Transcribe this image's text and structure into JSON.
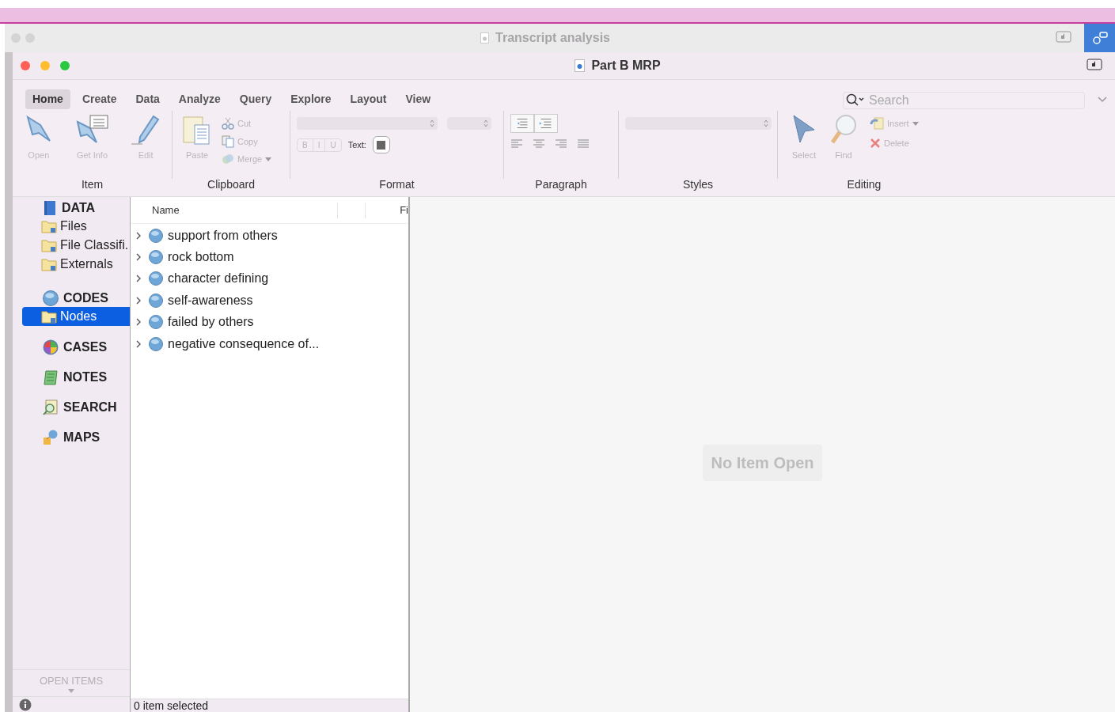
{
  "back_window": {
    "title": "Transcript analysis"
  },
  "window": {
    "title": "Part B MRP"
  },
  "ribbon": {
    "tabs": [
      {
        "label": "Home",
        "selected": true
      },
      {
        "label": "Create",
        "selected": false
      },
      {
        "label": "Data",
        "selected": false
      },
      {
        "label": "Analyze",
        "selected": false
      },
      {
        "label": "Query",
        "selected": false
      },
      {
        "label": "Explore",
        "selected": false
      },
      {
        "label": "Layout",
        "selected": false
      },
      {
        "label": "View",
        "selected": false
      }
    ],
    "search": {
      "placeholder": "Search"
    },
    "groups": [
      {
        "label": "Item",
        "items": [
          {
            "label": "Open",
            "disabled": true
          },
          {
            "label": "Get Info",
            "disabled": true
          },
          {
            "label": "Edit",
            "disabled": true
          }
        ]
      },
      {
        "label": "Clipboard",
        "items": [
          {
            "label": "Paste",
            "disabled": true
          },
          {
            "label": "Cut",
            "disabled": true
          },
          {
            "label": "Copy",
            "disabled": true
          },
          {
            "label": "Merge",
            "disabled": true
          }
        ]
      },
      {
        "label": "Format",
        "items": [
          {
            "label": "B",
            "disabled": true
          },
          {
            "label": "I",
            "disabled": true
          },
          {
            "label": "U",
            "disabled": true
          },
          {
            "label": "Text:",
            "disabled": false
          }
        ]
      },
      {
        "label": "Paragraph"
      },
      {
        "label": "Styles"
      },
      {
        "label": "Editing",
        "items": [
          {
            "label": "Select",
            "disabled": true
          },
          {
            "label": "Find",
            "disabled": true
          },
          {
            "label": "Insert",
            "disabled": true
          },
          {
            "label": "Delete",
            "disabled": true
          }
        ]
      }
    ]
  },
  "sidebar": {
    "sections": [
      {
        "label": "DATA",
        "items": [
          {
            "label": "Files",
            "selected": false
          },
          {
            "label": "File Classifi.",
            "selected": false
          },
          {
            "label": "Externals",
            "selected": false
          }
        ]
      },
      {
        "label": "CODES",
        "items": [
          {
            "label": "Nodes",
            "selected": true
          }
        ]
      },
      {
        "label": "CASES"
      },
      {
        "label": "NOTES"
      },
      {
        "label": "SEARCH"
      },
      {
        "label": "MAPS"
      }
    ],
    "footer": "OPEN ITEMS"
  },
  "list": {
    "columns": [
      "Name",
      "Fi"
    ],
    "rows": [
      {
        "name": "support from others",
        "expanded": false
      },
      {
        "name": "rock bottom",
        "expanded": false
      },
      {
        "name": "character defining",
        "expanded": false
      },
      {
        "name": "self-awareness",
        "expanded": false
      },
      {
        "name": "failed by others",
        "expanded": false
      },
      {
        "name": "negative consequence of...",
        "expanded": false
      }
    ],
    "status": "0 item selected"
  },
  "detail": {
    "message": "No Item Open"
  }
}
